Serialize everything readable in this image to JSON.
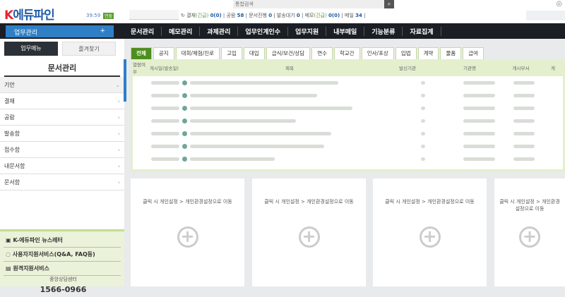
{
  "header": {
    "logo_k": "K",
    "logo_text": "에듀파인",
    "timer": "39:59",
    "extend_label": "연장",
    "search_placeholder": "통합검색",
    "stats": [
      {
        "label": "결재",
        "sub": "(긴급)",
        "value": "0(0)"
      },
      {
        "label": "공람",
        "value": "58"
      },
      {
        "label": "문서진행",
        "value": "0"
      },
      {
        "label": "발송대기",
        "value": "0"
      },
      {
        "label": "메모",
        "sub": "(긴급)",
        "value": "0(0)"
      },
      {
        "label": "메일",
        "value": "34"
      }
    ]
  },
  "nav": {
    "main_button": "업무관리",
    "plus": "+",
    "items": [
      "문서관리",
      "메모관리",
      "과제관리",
      "업무인계인수",
      "업무지원",
      "내부메일",
      "기능분류",
      "자료집계"
    ]
  },
  "sidebar": {
    "tabs": [
      "업무메뉴",
      "즐겨찾기"
    ],
    "title": "문서관리",
    "items": [
      "기안",
      "결재",
      "공람",
      "발송함",
      "접수함",
      "내문서함",
      "문서함"
    ],
    "links": [
      "K-에듀파인 뉴스레터",
      "사용자지원서비스(Q&A, FAQ등)",
      "원격지원서비스"
    ],
    "center_label": "중앙상담센터",
    "phone": "1566-0966"
  },
  "board": {
    "tabs": [
      "전체",
      "공지",
      "대회/체험/진로",
      "고입",
      "대입",
      "급식/보건/상담",
      "연수",
      "학교간",
      "인사/포상",
      "입법",
      "계약",
      "물품",
      "급여"
    ],
    "columns": [
      "열람여부",
      "게시일(발송일)",
      "제목",
      "발신기관",
      "기관명",
      "게시부서",
      "게"
    ]
  },
  "widgets": {
    "hint": "클릭 시 개인설정 > 개인환경설정으로 이동"
  }
}
